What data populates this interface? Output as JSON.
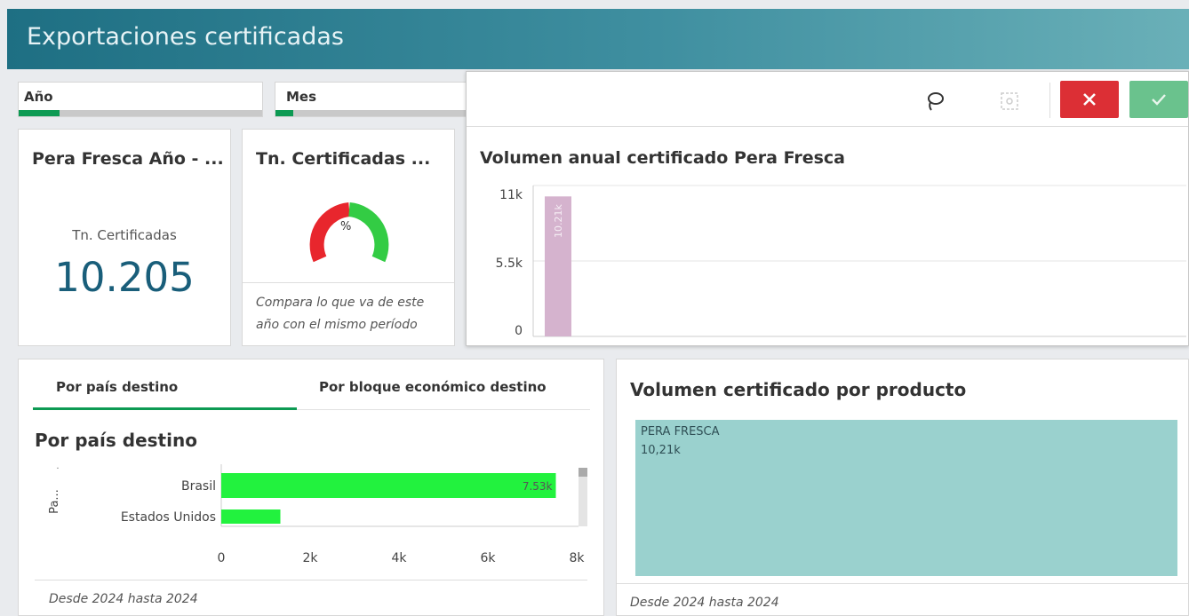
{
  "app": {
    "title": "Exportaciones certificadas"
  },
  "filters": [
    {
      "label": "Año"
    },
    {
      "label": "Mes"
    }
  ],
  "toolbar": {
    "lasso_icon": "lasso-icon",
    "clear_icon": "clear-selection-icon",
    "cancel_icon": "close-icon",
    "confirm_icon": "check-icon"
  },
  "kpi1": {
    "title": "Pera Fresca Año - ...",
    "label": "Tn. Certificadas",
    "value": "10.205"
  },
  "kpi2": {
    "title": "Tn. Certificadas ...",
    "gauge_label": "%",
    "footnote_1": "Compara lo que va de este",
    "footnote_2": "año con el mismo período"
  },
  "annual_chart": {
    "title": "Volumen anual certificado Pera Fresca",
    "chart_data": {
      "type": "bar",
      "values": [
        10205
      ],
      "data_labels": [
        "10.21k"
      ],
      "yticks": [
        "11k",
        "5.5k",
        "0"
      ],
      "ylim": [
        0,
        11000
      ],
      "color": "#d5b3ce"
    }
  },
  "country_panel": {
    "tabs": [
      "Por país destino",
      "Por bloque económico destino"
    ],
    "title": "Por país destino",
    "axis_label": "Pa...",
    "footer": "Desde 2024 hasta 2024",
    "chart_data": {
      "type": "bar",
      "orientation": "horizontal",
      "categories": [
        "Brasil",
        "Estados Unidos"
      ],
      "values": [
        7530,
        1330
      ],
      "data_labels": [
        "7.53k",
        ""
      ],
      "xticks": [
        "0",
        "2k",
        "4k",
        "6k",
        "8k"
      ],
      "xlim": [
        0,
        8000
      ],
      "color": "#22f23e"
    }
  },
  "product_panel": {
    "title": "Volumen certificado por producto",
    "footer": "Desde 2024 hasta 2024",
    "chart_data": {
      "type": "treemap",
      "items": [
        {
          "name": "PERA FRESCA",
          "value_label": "10,21k",
          "value": 10205
        }
      ],
      "color": "#9ad1ce"
    }
  }
}
